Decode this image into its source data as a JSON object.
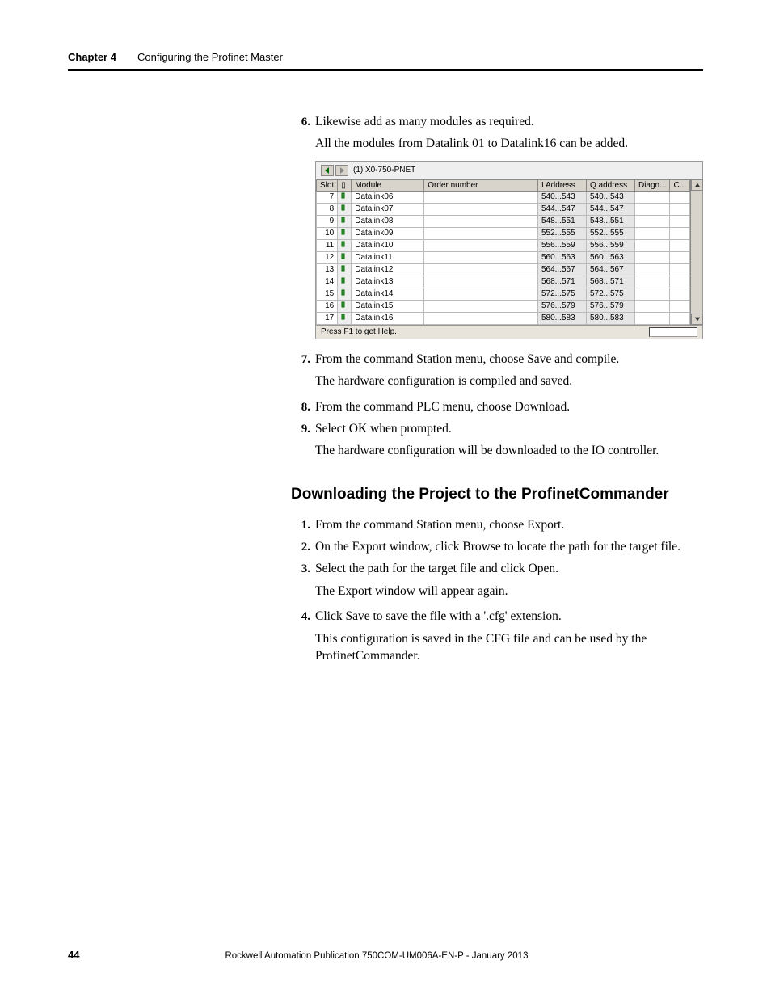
{
  "header": {
    "chapter_label": "Chapter 4",
    "chapter_title": "Configuring the Profinet Master"
  },
  "steps1": [
    {
      "n": "6.",
      "t": "Likewise add as many modules as required.",
      "sub": "All the modules from Datalink 01 to Datalink16 can be added."
    }
  ],
  "screenshot": {
    "title": "(1)   X0-750-PNET",
    "headers": [
      "Slot",
      "",
      "Module",
      "Order number",
      "I Address",
      "Q address",
      "Diagn...",
      "C..."
    ],
    "rows": [
      {
        "slot": "7",
        "module": "Datalink06",
        "iaddr": "540...543",
        "qaddr": "540...543"
      },
      {
        "slot": "8",
        "module": "Datalink07",
        "iaddr": "544...547",
        "qaddr": "544...547"
      },
      {
        "slot": "9",
        "module": "Datalink08",
        "iaddr": "548...551",
        "qaddr": "548...551"
      },
      {
        "slot": "10",
        "module": "Datalink09",
        "iaddr": "552...555",
        "qaddr": "552...555"
      },
      {
        "slot": "11",
        "module": "Datalink10",
        "iaddr": "556...559",
        "qaddr": "556...559"
      },
      {
        "slot": "12",
        "module": "Datalink11",
        "iaddr": "560...563",
        "qaddr": "560...563"
      },
      {
        "slot": "13",
        "module": "Datalink12",
        "iaddr": "564...567",
        "qaddr": "564...567"
      },
      {
        "slot": "14",
        "module": "Datalink13",
        "iaddr": "568...571",
        "qaddr": "568...571"
      },
      {
        "slot": "15",
        "module": "Datalink14",
        "iaddr": "572...575",
        "qaddr": "572...575"
      },
      {
        "slot": "16",
        "module": "Datalink15",
        "iaddr": "576...579",
        "qaddr": "576...579"
      },
      {
        "slot": "17",
        "module": "Datalink16",
        "iaddr": "580...583",
        "qaddr": "580...583"
      }
    ],
    "status": "Press F1 to get Help."
  },
  "steps2": [
    {
      "n": "7.",
      "t": "From the command Station menu, choose Save and compile.",
      "sub": "The hardware configuration is compiled and saved."
    },
    {
      "n": "8.",
      "t": "From the command PLC menu, choose Download."
    },
    {
      "n": "9.",
      "t": "Select OK when prompted.",
      "sub": "The hardware configuration will be downloaded to the IO controller."
    }
  ],
  "section_heading": "Downloading the Project to the ProfinetCommander",
  "steps3": [
    {
      "n": "1.",
      "t": "From the command Station menu, choose Export."
    },
    {
      "n": "2.",
      "t": "On the Export window, click Browse to locate the path for the target file."
    },
    {
      "n": "3.",
      "t": "Select the path for the target file and click Open.",
      "sub": "The Export window will appear again."
    },
    {
      "n": "4.",
      "t": "Click Save to save the file with a '.cfg' extension.",
      "sub": "This configuration is saved in the CFG file and can be used by the ProfinetCommander."
    }
  ],
  "footer": {
    "page": "44",
    "pub": "Rockwell Automation Publication 750COM-UM006A-EN-P - January 2013"
  }
}
